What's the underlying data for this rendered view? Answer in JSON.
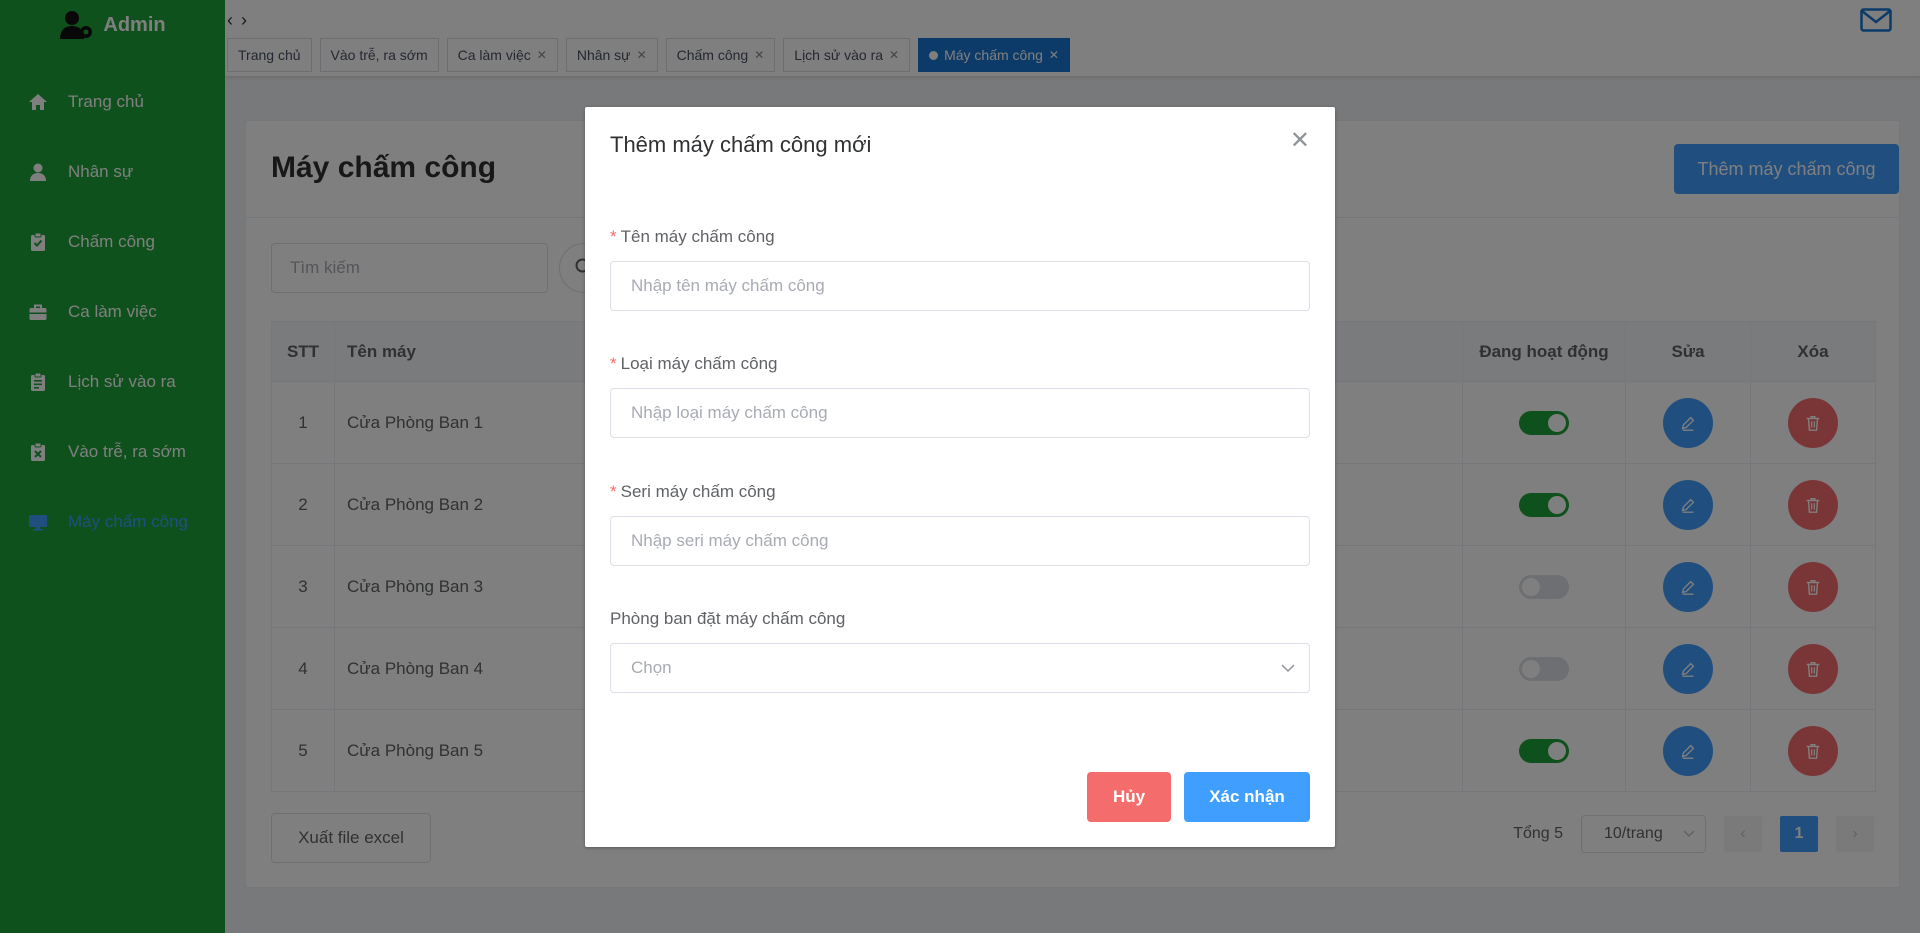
{
  "sidebar": {
    "brand": "Admin",
    "items": [
      {
        "label": "Trang chủ",
        "icon": "home-icon"
      },
      {
        "label": "Nhân sự",
        "icon": "user-icon"
      },
      {
        "label": "Chấm công",
        "icon": "clipboard-check-icon"
      },
      {
        "label": "Ca làm việc",
        "icon": "briefcase-icon"
      },
      {
        "label": "Lịch sử vào ra",
        "icon": "clipboard-list-icon"
      },
      {
        "label": "Vào trễ, ra sớm",
        "icon": "clipboard-x-icon"
      },
      {
        "label": "Máy chấm công",
        "icon": "monitor-icon",
        "active": true
      }
    ]
  },
  "tabs": [
    {
      "label": "Trang chủ"
    },
    {
      "label": "Vào trễ, ra sớm"
    },
    {
      "label": "Ca làm việc"
    },
    {
      "label": "Nhân sự"
    },
    {
      "label": "Chấm công"
    },
    {
      "label": "Lịch sử vào ra"
    },
    {
      "label": "Máy chấm công",
      "active": true
    }
  ],
  "page": {
    "title": "Máy chấm công",
    "add_button": "Thêm máy chấm công",
    "search_placeholder": "Tìm kiếm",
    "export_button": "Xuất file excel"
  },
  "table": {
    "headers": {
      "stt": "STT",
      "name": "Tên máy",
      "active": "Đang hoạt động",
      "edit": "Sửa",
      "delete": "Xóa"
    },
    "rows": [
      {
        "stt": "1",
        "name": "Cửa Phòng Ban 1",
        "active": true
      },
      {
        "stt": "2",
        "name": "Cửa Phòng Ban 2",
        "active": true
      },
      {
        "stt": "3",
        "name": "Cửa Phòng Ban 3",
        "active": false
      },
      {
        "stt": "4",
        "name": "Cửa Phòng Ban 4",
        "active": false
      },
      {
        "stt": "5",
        "name": "Cửa Phòng Ban 5",
        "active": true
      }
    ]
  },
  "pagination": {
    "total": "Tổng 5",
    "page_size": "10/trang",
    "current_page": "1"
  },
  "modal": {
    "title": "Thêm máy chấm công mới",
    "fields": [
      {
        "label": "Tên máy chấm công",
        "placeholder": "Nhập tên máy chấm công",
        "required": true
      },
      {
        "label": "Loại máy chấm công",
        "placeholder": "Nhập loại máy chấm công",
        "required": true
      },
      {
        "label": "Seri máy chấm công",
        "placeholder": "Nhập seri máy chấm công",
        "required": true
      }
    ],
    "select": {
      "label": "Phòng ban đặt máy chấm công",
      "placeholder": "Chọn"
    },
    "required_mark": "*",
    "cancel": "Hủy",
    "confirm": "Xác nhận"
  },
  "colors": {
    "sidebar": "#1fa33a",
    "primary": "#409eff",
    "danger": "#f56c6c",
    "active_tab": "#1976d2"
  }
}
